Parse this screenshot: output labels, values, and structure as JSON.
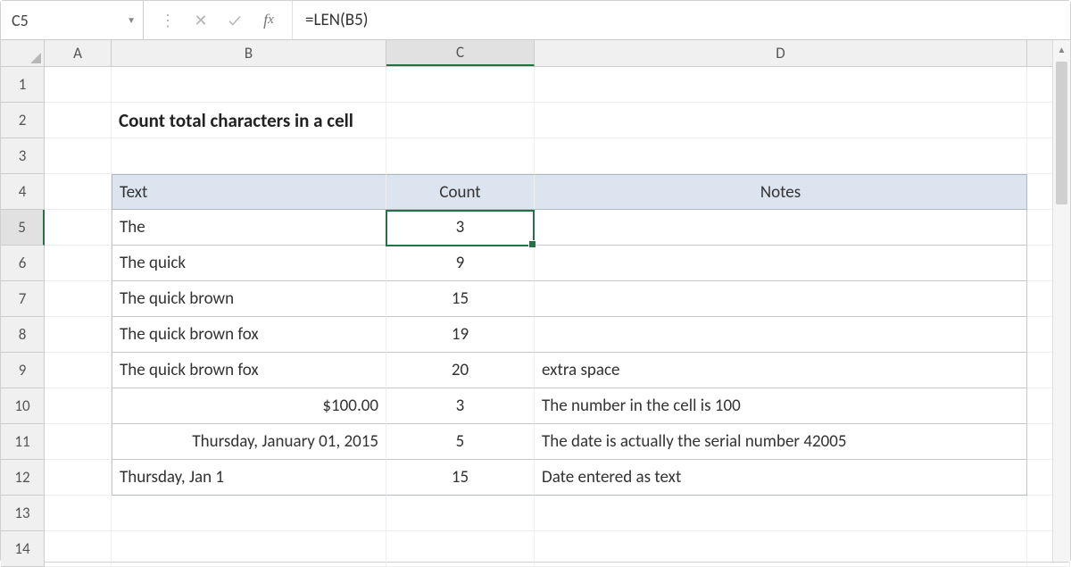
{
  "formula_bar": {
    "cell_ref": "C5",
    "formula": "=LEN(B5)"
  },
  "columns": [
    "A",
    "B",
    "C",
    "D"
  ],
  "row_numbers": [
    "1",
    "2",
    "3",
    "4",
    "5",
    "6",
    "7",
    "8",
    "9",
    "10",
    "11",
    "12",
    "13",
    "14"
  ],
  "title": "Count total characters in a cell",
  "table": {
    "headers": {
      "text": "Text",
      "count": "Count",
      "notes": "Notes"
    },
    "rows": [
      {
        "text": "The",
        "count": "3",
        "notes": ""
      },
      {
        "text": "The quick",
        "count": "9",
        "notes": ""
      },
      {
        "text": "The quick brown",
        "count": "15",
        "notes": ""
      },
      {
        "text": "The quick brown fox",
        "count": "19",
        "notes": ""
      },
      {
        "text": "The quick brown  fox",
        "count": "20",
        "notes": "extra space"
      },
      {
        "text": "$100.00",
        "count": "3",
        "notes": "The number in the cell is 100",
        "align": "right"
      },
      {
        "text": "Thursday, January 01, 2015",
        "count": "5",
        "notes": "The date is actually the serial number 42005",
        "align": "right"
      },
      {
        "text": "Thursday, Jan 1",
        "count": "15",
        "notes": "Date entered as text"
      }
    ]
  },
  "selected_cell": "C5"
}
